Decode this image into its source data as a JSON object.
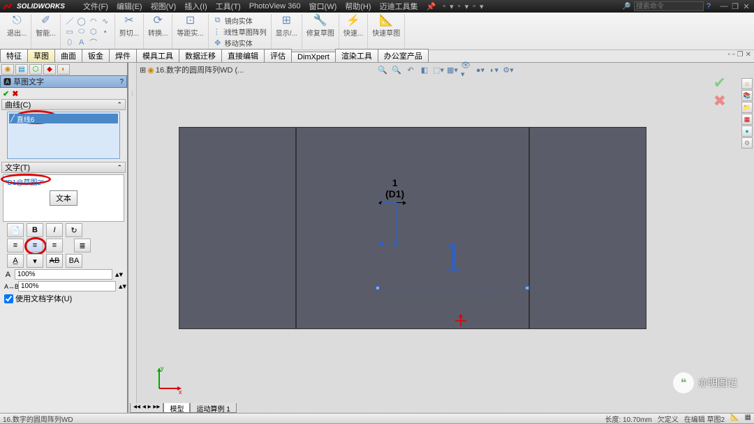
{
  "app": {
    "brand": "SOLIDWORKS"
  },
  "menu": {
    "file": "文件(F)",
    "edit": "编辑(E)",
    "view": "视图(V)",
    "insert": "插入(I)",
    "tools": "工具(T)",
    "photoview": "PhotoView 360",
    "window": "窗口(W)",
    "help": "帮助(H)",
    "maidi": "迈迪工具集"
  },
  "search": {
    "placeholder": "搜索命令"
  },
  "ribbon": {
    "exit": "退出...",
    "smart": "智能...",
    "cut": "剪切...",
    "convert": "转换...",
    "mirror": "镜向实体",
    "linear": "线性草图阵列",
    "move": "移动实体",
    "equal": "等距实...",
    "show": "显示/...",
    "repair": "修复草图",
    "quick": "快速...",
    "quick2": "快速草图"
  },
  "tabs": {
    "feature": "特征",
    "sketch": "草图",
    "surface": "曲面",
    "sheetmetal": "钣金",
    "weldment": "焊件",
    "mold": "模具工具",
    "migrate": "数据迁移",
    "direct": "直接编辑",
    "evaluate": "评估",
    "dimxpert": "DimXpert",
    "render": "渲染工具",
    "office": "办公室产品"
  },
  "doc": {
    "title": "16.数字的圆周阵列WD  (..."
  },
  "pm": {
    "title": "草图文字",
    "curve_section": "曲线(C)",
    "curve_selected": "直线6",
    "text_section": "文字(T)",
    "text_value": "\"D1@草图2\"",
    "text_button": "文本",
    "width_pct": "100%",
    "spacing_pct": "100%",
    "use_doc_font": "使用文档字体(U)"
  },
  "viewport": {
    "dim_number": "1",
    "dim_name": "(D1)",
    "big_char": "1",
    "axis_x": "x",
    "axis_y": "y"
  },
  "status": {
    "doc": "16.数字的圆周阵列WD",
    "length": "长度: 10.70mm",
    "def": "欠定义",
    "editing": "在编辑 草图2"
  },
  "bottom_tabs": {
    "model": "模型",
    "motion": "运动算例 1"
  },
  "watermark": {
    "text": "亦明图记"
  }
}
